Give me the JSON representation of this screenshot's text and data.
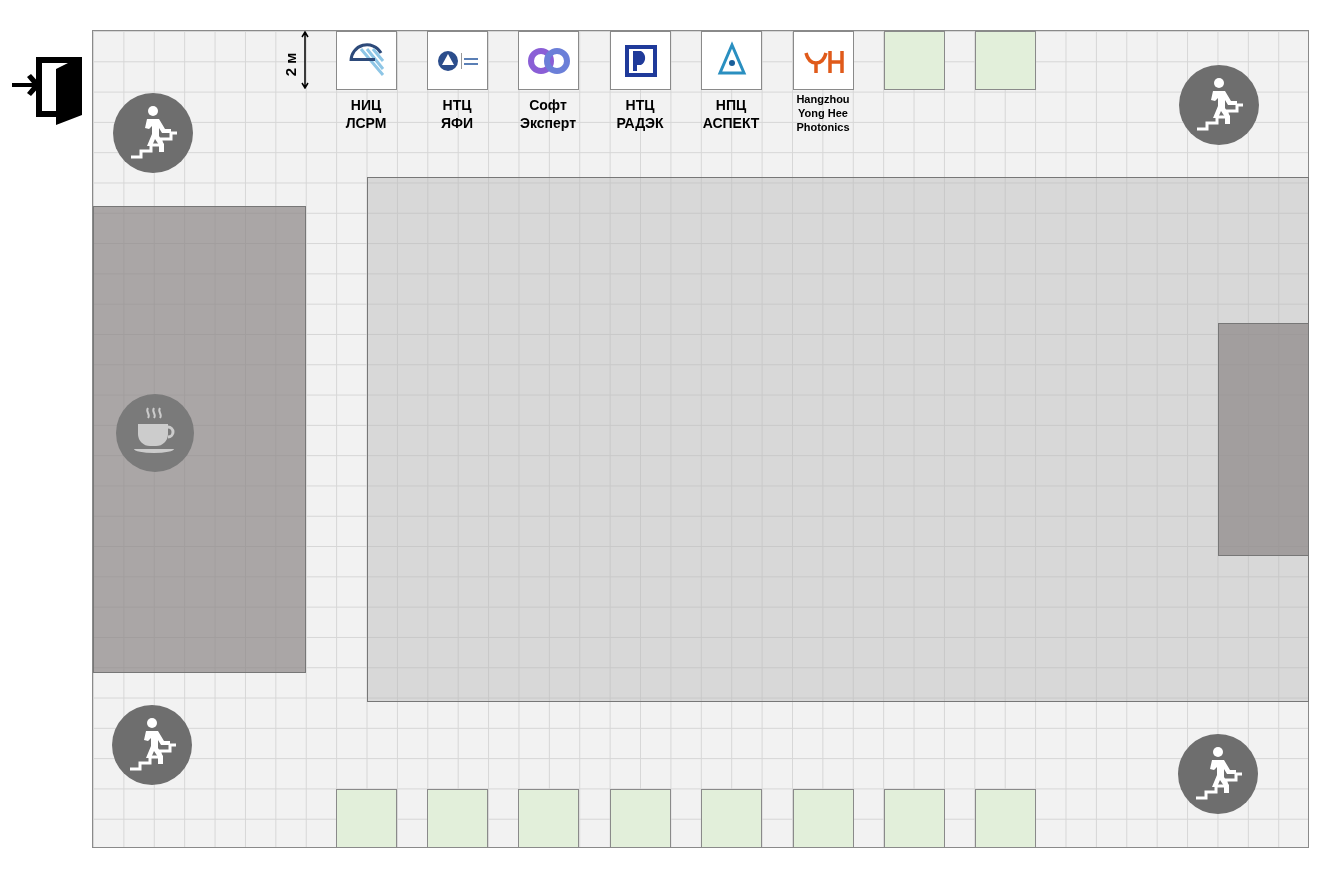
{
  "scale": {
    "label": "2 м"
  },
  "top_booths": [
    {
      "kind": "logo",
      "label_lines": [
        "НИЦ",
        "ЛСРМ"
      ]
    },
    {
      "kind": "logo",
      "label_lines": [
        "НТЦ",
        "ЯФИ"
      ]
    },
    {
      "kind": "logo",
      "label_lines": [
        "Софт",
        "Эксперт"
      ]
    },
    {
      "kind": "logo",
      "label_lines": [
        "НТЦ",
        "РАДЭК"
      ]
    },
    {
      "kind": "logo",
      "label_lines": [
        "НПЦ",
        "АСПЕКТ"
      ]
    },
    {
      "kind": "logo",
      "label_lines": [
        "Hangzhou",
        "Yong Hee",
        "Photonics"
      ]
    },
    {
      "kind": "empty"
    },
    {
      "kind": "empty"
    }
  ],
  "bottom_booths": [
    {
      "kind": "empty"
    },
    {
      "kind": "empty"
    },
    {
      "kind": "empty"
    },
    {
      "kind": "empty"
    },
    {
      "kind": "empty"
    },
    {
      "kind": "empty"
    },
    {
      "kind": "empty"
    },
    {
      "kind": "empty"
    }
  ]
}
